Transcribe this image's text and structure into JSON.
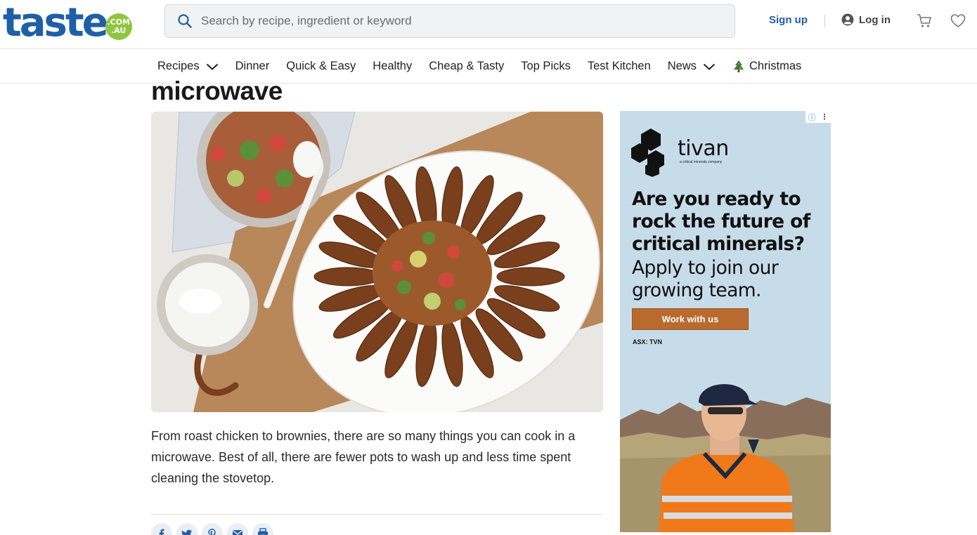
{
  "header": {
    "logo_word": "taste",
    "logo_badge_top": ".COM",
    "logo_badge_bottom": ".AU",
    "search_placeholder": "Search by recipe, ingredient or keyword",
    "signup_label": "Sign up",
    "login_label": "Log in",
    "icons": [
      "search-icon",
      "user-circle-icon",
      "cart-icon",
      "heart-icon"
    ]
  },
  "nav": {
    "items": [
      {
        "label": "Recipes",
        "has_dropdown": true
      },
      {
        "label": "Dinner",
        "has_dropdown": false
      },
      {
        "label": "Quick & Easy",
        "has_dropdown": false
      },
      {
        "label": "Healthy",
        "has_dropdown": false
      },
      {
        "label": "Cheap & Tasty",
        "has_dropdown": false
      },
      {
        "label": "Top Picks",
        "has_dropdown": false
      },
      {
        "label": "Test Kitchen",
        "has_dropdown": false
      },
      {
        "label": "News",
        "has_dropdown": true
      },
      {
        "label": "Christmas",
        "has_dropdown": false,
        "icon": "christmas-tree-icon"
      }
    ]
  },
  "article": {
    "title_visible": "microwave",
    "intro": "From roast chicken to brownies, there are so many things you can cook in a microwave. Best of all, there are fewer pots to wash up and less time spent cleaning the stovetop.",
    "share_icons": [
      "facebook-icon",
      "twitter-icon",
      "pinterest-icon",
      "email-icon",
      "print-icon"
    ]
  },
  "ad": {
    "brand": "tivan",
    "brand_tagline": "a critical minerals company",
    "headline": "Are you ready to rock the future of critical minerals?",
    "subhead": "Apply to join our growing team.",
    "cta_label": "Work with us",
    "ticker": "ASX: TVN",
    "info_glyph": "ⓘ",
    "more_glyph": "⋮"
  },
  "colors": {
    "brand_blue": "#1e5fa8",
    "brand_green": "#8ec63f",
    "ad_background": "#c7dce9",
    "ad_cta": "#b96a2f"
  }
}
